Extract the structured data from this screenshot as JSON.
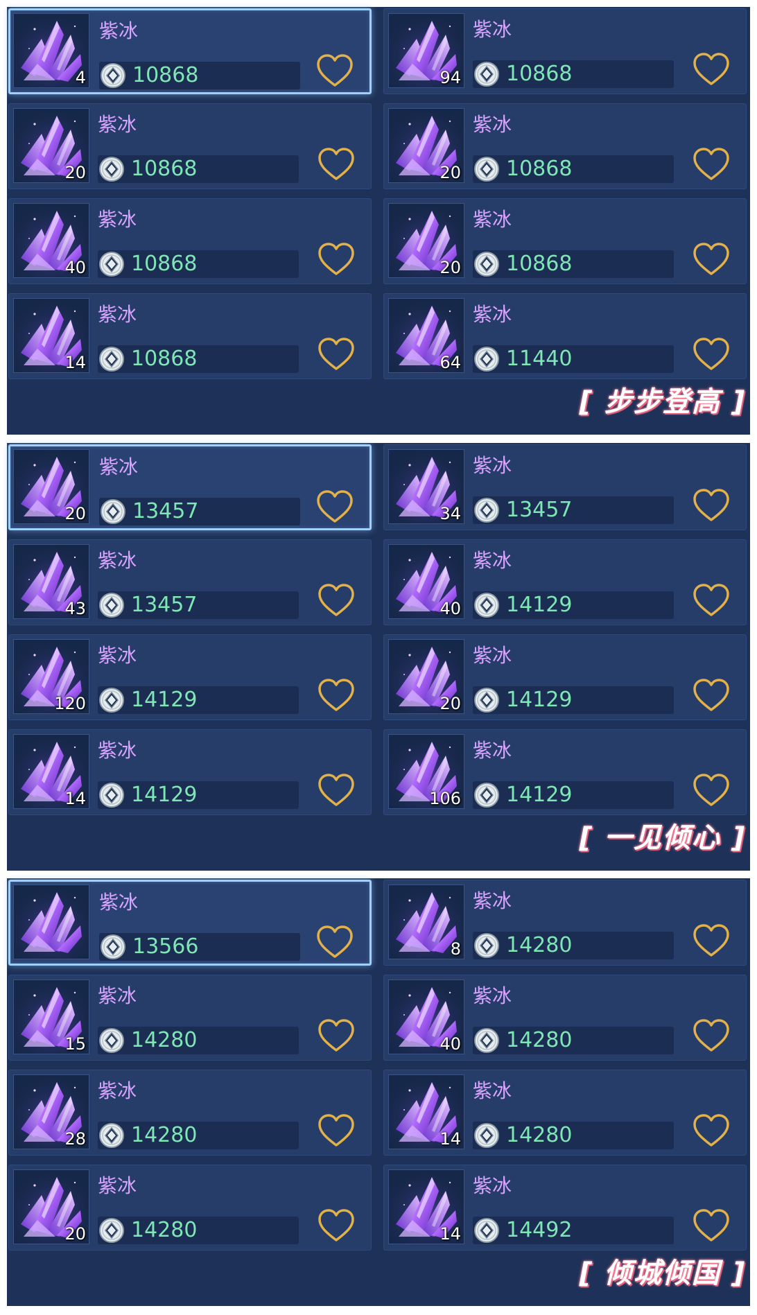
{
  "item_name": "紫冰",
  "colors": {
    "panel_bg": "#1e3158",
    "card_bg": "#263d69",
    "name": "#d9a4ff",
    "price": "#7fe6b5",
    "heart": "#e2b14a",
    "selected_border": "#9fd1ff"
  },
  "icons": {
    "item": "purple-crystal-icon",
    "currency": "silver-coin-icon",
    "favorite": "heart-outline-icon"
  },
  "sections": [
    {
      "title": "[ 步步登高 ]",
      "items": [
        {
          "qty": "4",
          "price": "10868",
          "selected": true
        },
        {
          "qty": "94",
          "price": "10868",
          "selected": false
        },
        {
          "qty": "20",
          "price": "10868",
          "selected": false
        },
        {
          "qty": "20",
          "price": "10868",
          "selected": false
        },
        {
          "qty": "40",
          "price": "10868",
          "selected": false
        },
        {
          "qty": "20",
          "price": "10868",
          "selected": false
        },
        {
          "qty": "14",
          "price": "10868",
          "selected": false
        },
        {
          "qty": "64",
          "price": "11440",
          "selected": false
        }
      ]
    },
    {
      "title": "[ 一见倾心 ]",
      "items": [
        {
          "qty": "20",
          "price": "13457",
          "selected": true
        },
        {
          "qty": "34",
          "price": "13457",
          "selected": false
        },
        {
          "qty": "43",
          "price": "13457",
          "selected": false
        },
        {
          "qty": "40",
          "price": "14129",
          "selected": false
        },
        {
          "qty": "120",
          "price": "14129",
          "selected": false
        },
        {
          "qty": "20",
          "price": "14129",
          "selected": false
        },
        {
          "qty": "14",
          "price": "14129",
          "selected": false
        },
        {
          "qty": "106",
          "price": "14129",
          "selected": false
        }
      ]
    },
    {
      "title": "[ 倾城倾国 ]",
      "items": [
        {
          "qty": "",
          "price": "13566",
          "selected": true
        },
        {
          "qty": "8",
          "price": "14280",
          "selected": false
        },
        {
          "qty": "15",
          "price": "14280",
          "selected": false
        },
        {
          "qty": "40",
          "price": "14280",
          "selected": false
        },
        {
          "qty": "28",
          "price": "14280",
          "selected": false
        },
        {
          "qty": "14",
          "price": "14280",
          "selected": false
        },
        {
          "qty": "20",
          "price": "14280",
          "selected": false
        },
        {
          "qty": "14",
          "price": "14492",
          "selected": false
        }
      ]
    }
  ]
}
